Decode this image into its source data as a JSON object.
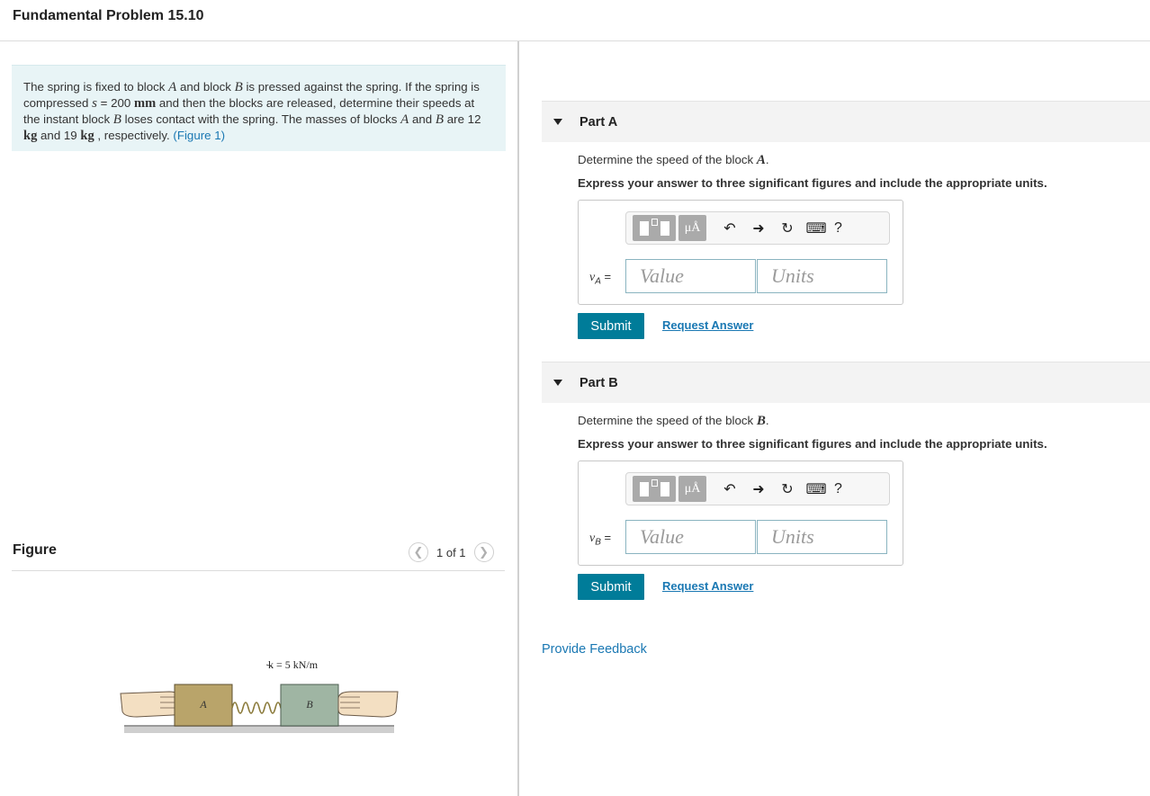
{
  "page_title": "Fundamental Problem 15.10",
  "problem": {
    "t1": "The spring is fixed to block ",
    "A": "A",
    "t2": " and block ",
    "B": "B",
    "t3": " is pressed against the spring. If the spring is compressed ",
    "s": "s",
    "t4": " = 200 ",
    "mm": "mm",
    "t5": " and then the blocks are released, determine their speeds at the instant block ",
    "t6": " loses contact with the spring. The masses of blocks ",
    "t7": " and ",
    "t8": " are 12 ",
    "kg": "kg",
    "t9": " and 19 ",
    "t10": " , respectively. ",
    "figure_link": "(Figure 1)"
  },
  "figure": {
    "label": "Figure",
    "pager_text": "1 of 1",
    "prev_icon": "chevron-left-icon",
    "next_icon": "chevron-right-icon",
    "spring_label": "k = 5 kN/m",
    "block_a_label": "A",
    "block_b_label": "B",
    "colors": {
      "block_a": "#b9a46a",
      "block_b": "#9fb5a3",
      "ground": "#cfcfcf",
      "hand": "#f3dfc2"
    }
  },
  "parts": [
    {
      "title": "Part A",
      "q_text": "Determine the speed of the block ",
      "q_var": "A",
      "q_end": ".",
      "instruction": "Express your answer to three significant figures and include the appropriate units.",
      "var_symbol": "v",
      "var_sub": "A",
      "var_eq": "=",
      "value_placeholder": "Value",
      "units_placeholder": "Units",
      "submit_label": "Submit",
      "request_label": "Request Answer"
    },
    {
      "title": "Part B",
      "q_text": "Determine the speed of the block ",
      "q_var": "B",
      "q_end": ".",
      "instruction": "Express your answer to three significant figures and include the appropriate units.",
      "var_symbol": "v",
      "var_sub": "B",
      "var_eq": "=",
      "value_placeholder": "Value",
      "units_placeholder": "Units",
      "submit_label": "Submit",
      "request_label": "Request Answer"
    }
  ],
  "toolbar": {
    "templates_icon": "templates-icon",
    "units_label": "μÅ",
    "undo_icon": "undo-icon",
    "redo_icon": "redo-icon",
    "reset_icon": "reset-icon",
    "keyboard_icon": "keyboard-icon",
    "help_label": "?"
  },
  "feedback_label": "Provide Feedback",
  "colors": {
    "accent": "#007c99",
    "link": "#1a78b3",
    "problem_bg": "#e8f4f6"
  }
}
